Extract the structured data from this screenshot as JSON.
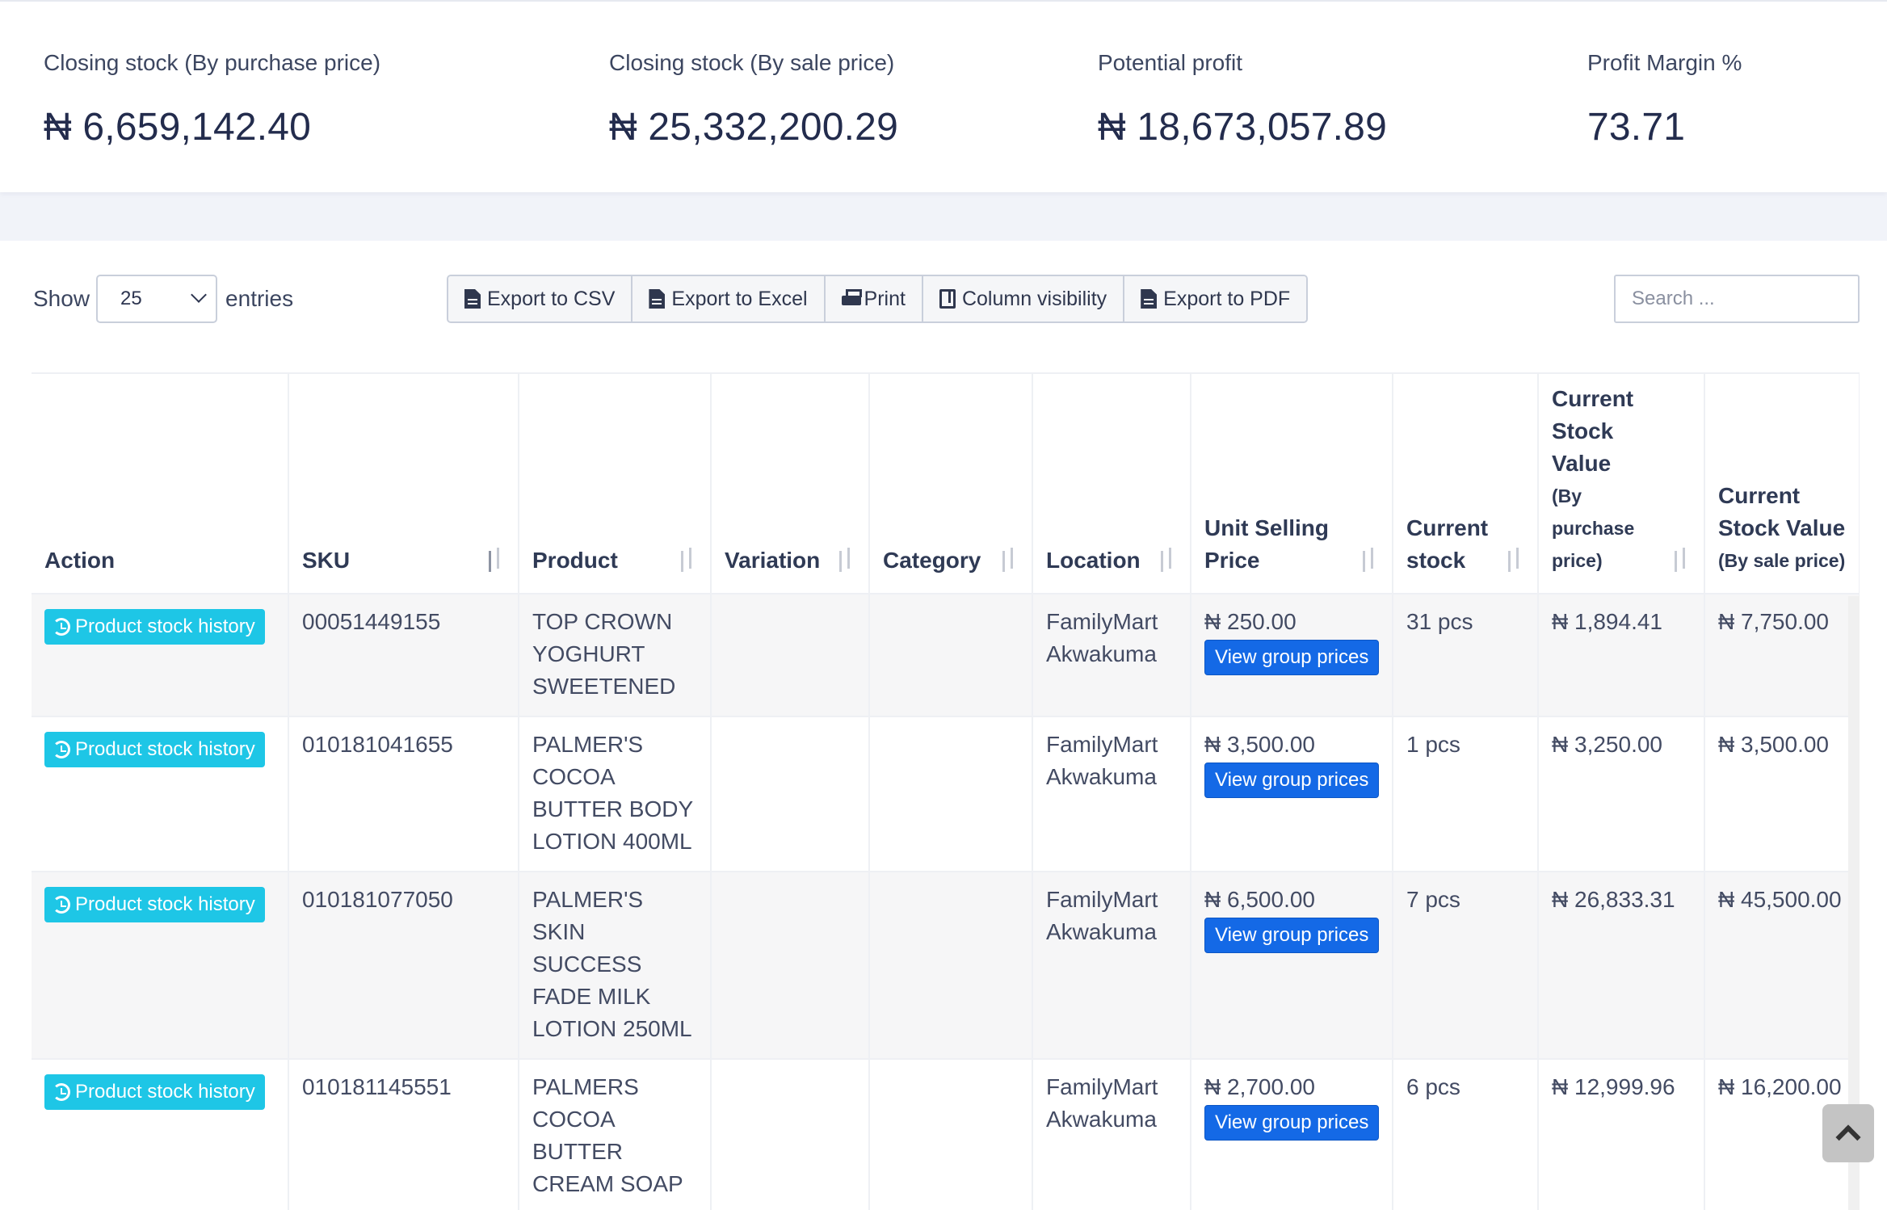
{
  "summary": {
    "closing_purchase": {
      "label": "Closing stock (By purchase price)",
      "value": "₦ 6,659,142.40"
    },
    "closing_sale": {
      "label": "Closing stock (By sale price)",
      "value": "₦ 25,332,200.29"
    },
    "potential_profit": {
      "label": "Potential profit",
      "value": "₦ 18,673,057.89"
    },
    "profit_margin": {
      "label": "Profit Margin %",
      "value": "73.71"
    }
  },
  "controls": {
    "show_label": "Show",
    "entries_label": "entries",
    "page_size": "25",
    "export_csv": "Export to CSV",
    "export_excel": "Export to Excel",
    "print": "Print",
    "column_visibility": "Column visibility",
    "export_pdf": "Export to PDF",
    "search_placeholder": "Search ..."
  },
  "table": {
    "headers": {
      "action": "Action",
      "sku": "SKU",
      "product": "Product",
      "variation": "Variation",
      "category": "Category",
      "location": "Location",
      "unit_selling_price": "Unit Selling Price",
      "current_stock": "Current stock",
      "csv_purchase_main": "Current Stock Value",
      "csv_purchase_sub": "(By purchase price)",
      "csv_sale_main": "Current Stock Value",
      "csv_sale_sub": "(By sale price)"
    },
    "history_label": "Product stock history",
    "group_prices_label": "View group prices",
    "rows": [
      {
        "sku": "00051449155",
        "product": "TOP CROWN YOGHURT SWEETENED",
        "variation": "",
        "category": "",
        "location": "FamilyMart Akwakuma",
        "price": "₦ 250.00",
        "stock": "31 pcs",
        "value_purchase": "₦ 1,894.41",
        "value_sale": "₦ 7,750.00"
      },
      {
        "sku": "010181041655",
        "product": "PALMER'S COCOA BUTTER BODY LOTION 400ML",
        "variation": "",
        "category": "",
        "location": "FamilyMart Akwakuma",
        "price": "₦ 3,500.00",
        "stock": "1 pcs",
        "value_purchase": "₦ 3,250.00",
        "value_sale": "₦ 3,500.00"
      },
      {
        "sku": "010181077050",
        "product": "PALMER'S SKIN SUCCESS FADE MILK LOTION 250ML",
        "variation": "",
        "category": "",
        "location": "FamilyMart Akwakuma",
        "price": "₦ 6,500.00",
        "stock": "7 pcs",
        "value_purchase": "₦ 26,833.31",
        "value_sale": "₦ 45,500.00"
      },
      {
        "sku": "010181145551",
        "product": "PALMERS COCOA BUTTER CREAM SOAP",
        "variation": "",
        "category": "",
        "location": "FamilyMart Akwakuma",
        "price": "₦ 2,700.00",
        "stock": "6 pcs",
        "value_purchase": "₦ 12,999.96",
        "value_sale": "₦ 16,200.00"
      }
    ]
  }
}
